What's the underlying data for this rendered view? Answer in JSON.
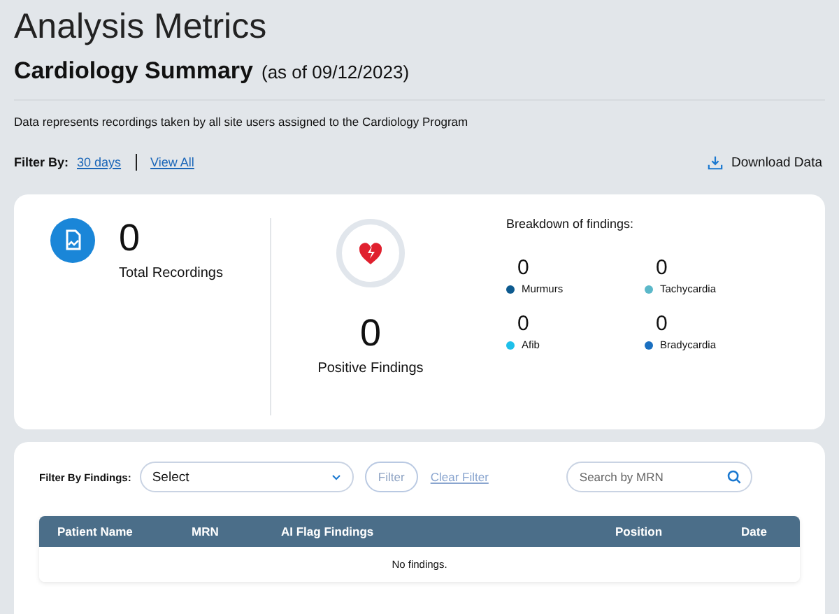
{
  "page": {
    "title": "Analysis Metrics",
    "subtitle": "Cardiology Summary",
    "as_of": "(as of 09/12/2023)",
    "description": "Data represents recordings taken by all site users assigned to the Cardiology Program"
  },
  "filter": {
    "label": "Filter By:",
    "links": [
      "30 days",
      "View All"
    ],
    "download": "Download Data"
  },
  "summary": {
    "total": {
      "value": "0",
      "label": "Total Recordings"
    },
    "positive": {
      "value": "0",
      "label": "Positive Findings"
    },
    "breakdown_title": "Breakdown of findings:",
    "breakdown": [
      {
        "value": "0",
        "label": "Murmurs",
        "color": "#0d5a8f"
      },
      {
        "value": "0",
        "label": "Tachycardia",
        "color": "#5bb8c9"
      },
      {
        "value": "0",
        "label": "Afib",
        "color": "#1ec0ea"
      },
      {
        "value": "0",
        "label": "Bradycardia",
        "color": "#1a6fc0"
      }
    ]
  },
  "findings": {
    "label": "Filter By Findings:",
    "select": "Select",
    "filter_button": "Filter",
    "clear": "Clear Filter",
    "search_placeholder": "Search by MRN",
    "table": {
      "columns": [
        "Patient Name",
        "MRN",
        "AI Flag Findings",
        "Position",
        "Date"
      ],
      "empty": "No findings."
    }
  }
}
